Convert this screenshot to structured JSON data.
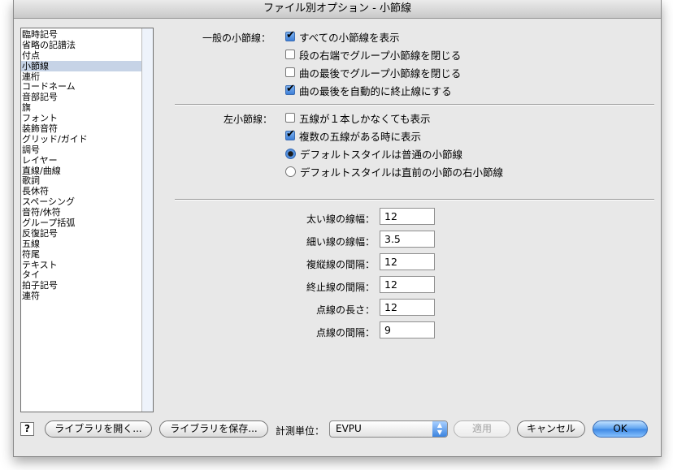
{
  "window": {
    "title": "ファイル別オプション - 小節線"
  },
  "sidebar": {
    "items": [
      {
        "label": "臨時記号",
        "selected": false
      },
      {
        "label": "省略の記譜法",
        "selected": false
      },
      {
        "label": "付点",
        "selected": false
      },
      {
        "label": "小節線",
        "selected": true
      },
      {
        "label": "連桁",
        "selected": false
      },
      {
        "label": "コードネーム",
        "selected": false
      },
      {
        "label": "音部記号",
        "selected": false
      },
      {
        "label": "旗",
        "selected": false
      },
      {
        "label": "フォント",
        "selected": false
      },
      {
        "label": "装飾音符",
        "selected": false
      },
      {
        "label": "グリッド/ガイド",
        "selected": false
      },
      {
        "label": "調号",
        "selected": false
      },
      {
        "label": "レイヤー",
        "selected": false
      },
      {
        "label": "直線/曲線",
        "selected": false
      },
      {
        "label": "歌詞",
        "selected": false
      },
      {
        "label": "長休符",
        "selected": false
      },
      {
        "label": "スペーシング",
        "selected": false
      },
      {
        "label": "音符/休符",
        "selected": false
      },
      {
        "label": "グループ括弧",
        "selected": false
      },
      {
        "label": "反復記号",
        "selected": false
      },
      {
        "label": "五線",
        "selected": false
      },
      {
        "label": "符尾",
        "selected": false
      },
      {
        "label": "テキスト",
        "selected": false
      },
      {
        "label": "タイ",
        "selected": false
      },
      {
        "label": "拍子記号",
        "selected": false
      },
      {
        "label": "連符",
        "selected": false
      }
    ]
  },
  "general": {
    "label": "一般の小節線：",
    "options": [
      {
        "label": "すべての小節線を表示",
        "checked": true
      },
      {
        "label": "段の右端でグループ小節線を閉じる",
        "checked": false
      },
      {
        "label": "曲の最後でグループ小節線を閉じる",
        "checked": false
      },
      {
        "label": "曲の最後を自動的に終止線にする",
        "checked": true
      }
    ]
  },
  "left": {
    "label": "左小節線：",
    "checks": [
      {
        "label": "五線が１本しかなくても表示",
        "checked": false
      },
      {
        "label": "複数の五線がある時に表示",
        "checked": true
      }
    ],
    "radios": [
      {
        "label": "デフォルトスタイルは普通の小節線",
        "selected": true
      },
      {
        "label": "デフォルトスタイルは直前の小節の右小節線",
        "selected": false
      }
    ]
  },
  "fields": [
    {
      "label": "太い線の線幅：",
      "value": "12"
    },
    {
      "label": "細い線の線幅：",
      "value": "3.5"
    },
    {
      "label": "複縦線の間隔：",
      "value": "12"
    },
    {
      "label": "終止線の間隔：",
      "value": "12"
    },
    {
      "label": "点線の長さ：",
      "value": "12"
    },
    {
      "label": "点線の間隔：",
      "value": "9"
    }
  ],
  "footer": {
    "help": "?",
    "open_library": "ライブラリを開く...",
    "save_library": "ライブラリを保存...",
    "units_label": "計測単位：",
    "units_value": "EVPU",
    "apply": "適用",
    "cancel": "キャンセル",
    "ok": "OK"
  }
}
